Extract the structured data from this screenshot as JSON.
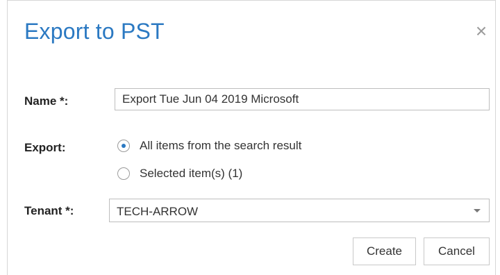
{
  "dialog": {
    "title": "Export to PST",
    "close_glyph": "×",
    "close_icon": "close-icon"
  },
  "form": {
    "name_label": "Name *:",
    "name_value": "Export Tue Jun 04 2019 Microsoft",
    "export_label": "Export:",
    "export_options": [
      {
        "label": "All items from the search result",
        "selected": true
      },
      {
        "label": "Selected item(s) (1)",
        "selected": false
      }
    ],
    "tenant_label": "Tenant *:",
    "tenant_value": "TECH-ARROW"
  },
  "buttons": {
    "create_label": "Create",
    "cancel_label": "Cancel"
  },
  "colors": {
    "accent": "#2b79c2",
    "border": "#bdbdbd"
  }
}
